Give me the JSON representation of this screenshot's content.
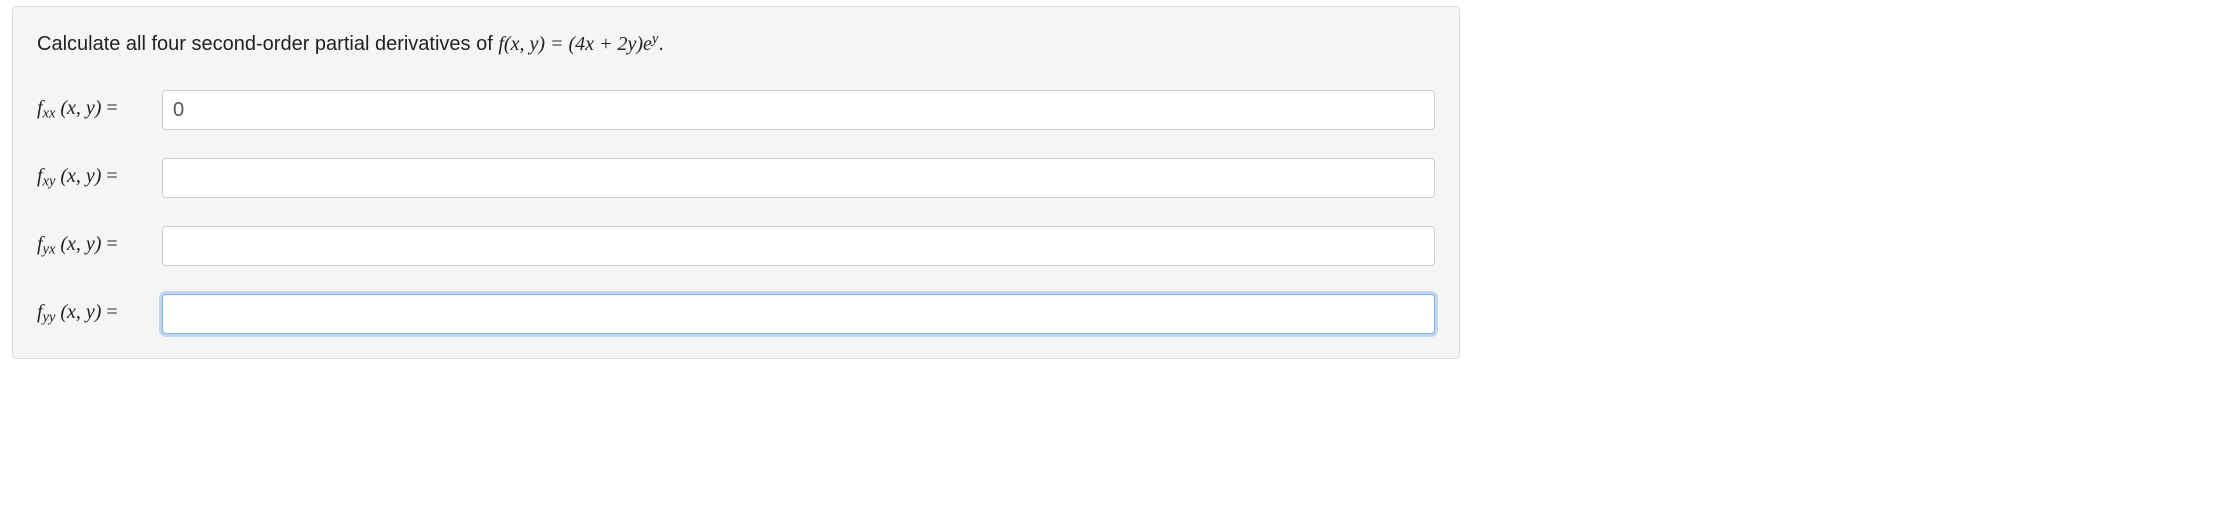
{
  "prompt": {
    "intro": "Calculate all four second-order partial derivatives of ",
    "func_name": "f",
    "vars": "(x, y) = (4x + 2y)e",
    "exponent": "y",
    "period": "."
  },
  "rows": [
    {
      "sub": "xx",
      "value": "0",
      "placeholder": "",
      "focused": false
    },
    {
      "sub": "xy",
      "value": "",
      "placeholder": "",
      "focused": false
    },
    {
      "sub": "yx",
      "value": "",
      "placeholder": "",
      "focused": false
    },
    {
      "sub": "yy",
      "value": "",
      "placeholder": "",
      "focused": true
    }
  ]
}
